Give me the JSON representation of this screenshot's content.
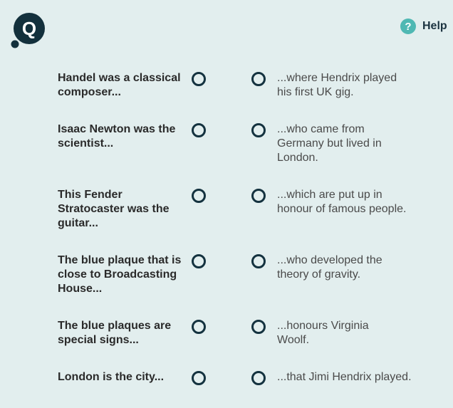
{
  "header": {
    "logo_icon": "quiz-logo-icon",
    "logo_letter": "Q",
    "help_icon": "question-mark-icon",
    "help_icon_glyph": "?",
    "help_label": "Help"
  },
  "colors": {
    "background": "#e2eeee",
    "logo": "#13303c",
    "radio_border": "#14323f",
    "help_icon": "#4fb8b3"
  },
  "pairs": [
    {
      "prompt": "Handel was a classical composer...",
      "answer": "...where Hendrix played his first UK gig."
    },
    {
      "prompt": "Isaac Newton was the scientist...",
      "answer": "...who came from Germany but lived in London."
    },
    {
      "prompt": "This Fender Stratocaster was the guitar...",
      "answer": "...which are put up in honour of famous people."
    },
    {
      "prompt": "The blue plaque that is close to Broadcasting House...",
      "answer": "...who developed the theory of gravity."
    },
    {
      "prompt": "The blue plaques are special signs...",
      "answer": "...honours Virginia Woolf."
    },
    {
      "prompt": "London is the city...",
      "answer": "...that Jimi Hendrix played."
    }
  ]
}
